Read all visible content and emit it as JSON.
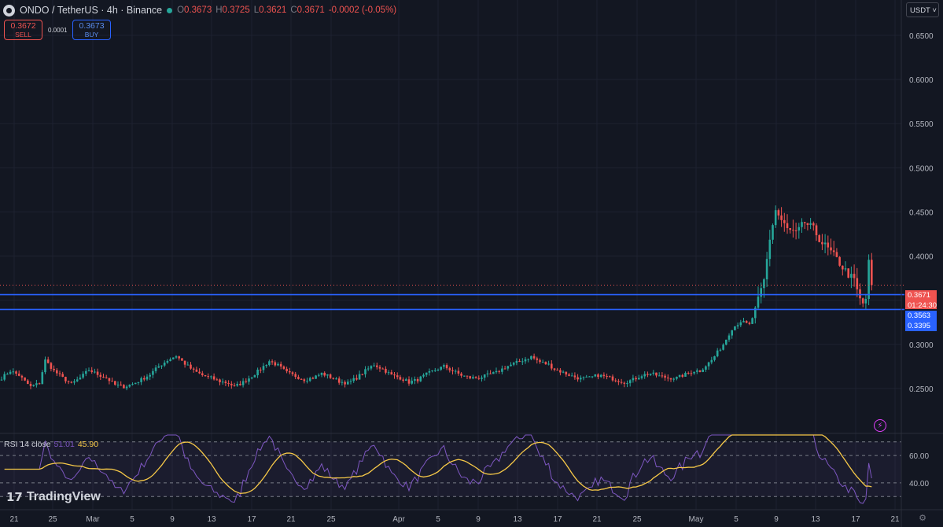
{
  "header": {
    "symbol": "ONDO / TetherUS · 4h · Binance",
    "ohlc": {
      "o_label": "O",
      "o": "0.3673",
      "h_label": "H",
      "h": "0.3725",
      "l_label": "L",
      "l": "0.3621",
      "c_label": "C",
      "c": "0.3671",
      "change": "-0.0002 (-0.05%)"
    }
  },
  "trade": {
    "sell_price": "0.3672",
    "sell_label": "SELL",
    "spread": "0.0001",
    "buy_price": "0.3673",
    "buy_label": "BUY"
  },
  "currency_button": "USDT",
  "price_labels": {
    "last_price": "0.3671",
    "countdown": "01:24:30",
    "line_1": "0.3563",
    "line_2": "0.3395"
  },
  "rsi": {
    "name": "RSI 14 close",
    "value": "51.01",
    "ma_value": "45.90"
  },
  "branding": "TradingView",
  "colors": {
    "background": "#131722",
    "up": "#26a69a",
    "down": "#ef5350",
    "hline": "#2962ff",
    "rsi": "#7e57c2",
    "rsi_ma": "#f7c948"
  },
  "chart_data": {
    "type": "candlestick",
    "title": "ONDO / TetherUS · 4h · Binance",
    "y_ticks": [
      "0.6500",
      "0.6000",
      "0.5500",
      "0.5000",
      "0.4500",
      "0.4000",
      "0.3500",
      "0.3000",
      "0.2500"
    ],
    "ylim": [
      0.2,
      0.69
    ],
    "x_ticks": [
      "21",
      "25",
      "Mar",
      "5",
      "9",
      "13",
      "17",
      "21",
      "25",
      "Apr",
      "5",
      "9",
      "13",
      "17",
      "21",
      "25",
      "May",
      "5",
      "9",
      "13",
      "17",
      "21"
    ],
    "horizontal_lines": [
      0.3563,
      0.3395
    ],
    "last_price": 0.3671,
    "price_path": [
      [
        0,
        0.262
      ],
      [
        3,
        0.27
      ],
      [
        6,
        0.265
      ],
      [
        8,
        0.258
      ],
      [
        10,
        0.252
      ],
      [
        13,
        0.256
      ],
      [
        15,
        0.282
      ],
      [
        18,
        0.27
      ],
      [
        21,
        0.262
      ],
      [
        24,
        0.255
      ],
      [
        27,
        0.262
      ],
      [
        30,
        0.271
      ],
      [
        33,
        0.266
      ],
      [
        36,
        0.262
      ],
      [
        39,
        0.254
      ],
      [
        42,
        0.252
      ],
      [
        45,
        0.255
      ],
      [
        48,
        0.26
      ],
      [
        51,
        0.266
      ],
      [
        54,
        0.275
      ],
      [
        57,
        0.282
      ],
      [
        60,
        0.287
      ],
      [
        63,
        0.278
      ],
      [
        66,
        0.27
      ],
      [
        69,
        0.265
      ],
      [
        72,
        0.262
      ],
      [
        75,
        0.258
      ],
      [
        78,
        0.256
      ],
      [
        80,
        0.252
      ],
      [
        83,
        0.257
      ],
      [
        86,
        0.264
      ],
      [
        89,
        0.272
      ],
      [
        92,
        0.281
      ],
      [
        95,
        0.276
      ],
      [
        98,
        0.268
      ],
      [
        101,
        0.264
      ],
      [
        104,
        0.26
      ],
      [
        107,
        0.262
      ],
      [
        110,
        0.267
      ],
      [
        113,
        0.263
      ],
      [
        116,
        0.258
      ],
      [
        119,
        0.256
      ],
      [
        122,
        0.262
      ],
      [
        125,
        0.27
      ],
      [
        128,
        0.277
      ],
      [
        131,
        0.272
      ],
      [
        134,
        0.265
      ],
      [
        137,
        0.262
      ],
      [
        140,
        0.257
      ],
      [
        143,
        0.26
      ],
      [
        146,
        0.266
      ],
      [
        149,
        0.271
      ],
      [
        152,
        0.275
      ],
      [
        155,
        0.27
      ],
      [
        158,
        0.265
      ],
      [
        161,
        0.262
      ],
      [
        164,
        0.262
      ],
      [
        167,
        0.265
      ],
      [
        170,
        0.268
      ],
      [
        173,
        0.274
      ],
      [
        176,
        0.278
      ],
      [
        179,
        0.282
      ],
      [
        182,
        0.286
      ],
      [
        185,
        0.28
      ],
      [
        188,
        0.277
      ],
      [
        190,
        0.272
      ],
      [
        193,
        0.268
      ],
      [
        196,
        0.264
      ],
      [
        199,
        0.261
      ],
      [
        202,
        0.262
      ],
      [
        205,
        0.265
      ],
      [
        208,
        0.263
      ],
      [
        211,
        0.26
      ],
      [
        214,
        0.257
      ],
      [
        217,
        0.26
      ],
      [
        220,
        0.265
      ],
      [
        223,
        0.267
      ],
      [
        226,
        0.264
      ],
      [
        229,
        0.262
      ],
      [
        232,
        0.262
      ],
      [
        235,
        0.266
      ],
      [
        238,
        0.27
      ],
      [
        240,
        0.27
      ]
    ],
    "rsi_ylim": [
      25,
      75
    ],
    "rsi_levels": [
      70,
      60,
      40,
      30
    ],
    "rsi_tick_labels": [
      "60.00",
      "40.00"
    ]
  }
}
